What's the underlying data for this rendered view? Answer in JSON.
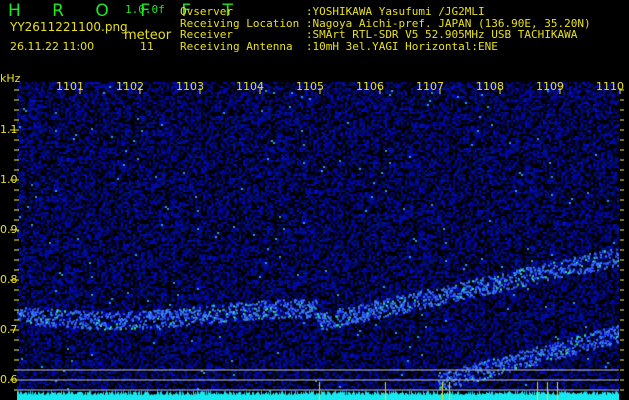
{
  "header": {
    "app_title": "H R O F F T",
    "version": "1.0.0f",
    "filename": "YY2611221100.png",
    "mode": "meteor",
    "datetime": "26.11.22 11:00",
    "count": "11"
  },
  "info": [
    {
      "label": "Ovserver           ",
      "value": ":YOSHIKAWA Yasufumi /JG2MLI"
    },
    {
      "label": "Receiving Location ",
      "value": ":Nagoya Aichi-pref. JAPAN (136.90E, 35.20N)"
    },
    {
      "label": "Receiver           ",
      "value": ":SMArt RTL-SDR V5 52.905MHz USB TACHIKAWA"
    },
    {
      "label": "Receiving Antenna  ",
      "value": ":10mH 3el.YAGI Horizontal:ENE"
    }
  ],
  "y_axis": {
    "unit": "kHz",
    "labels": [
      "1.1",
      "1.0",
      "0.9",
      "0.8",
      "0.7",
      "0.6"
    ]
  },
  "x_axis": {
    "labels": [
      "1101",
      "1102",
      "1103",
      "1104",
      "1105",
      "1106",
      "1107",
      "1108",
      "1109",
      "1110"
    ]
  },
  "colors": {
    "header": "#1ee81e",
    "text": "#e8e01a",
    "noise": "#0a10a0",
    "echo": "#3a6cff",
    "floor": "#18e8f0"
  }
}
